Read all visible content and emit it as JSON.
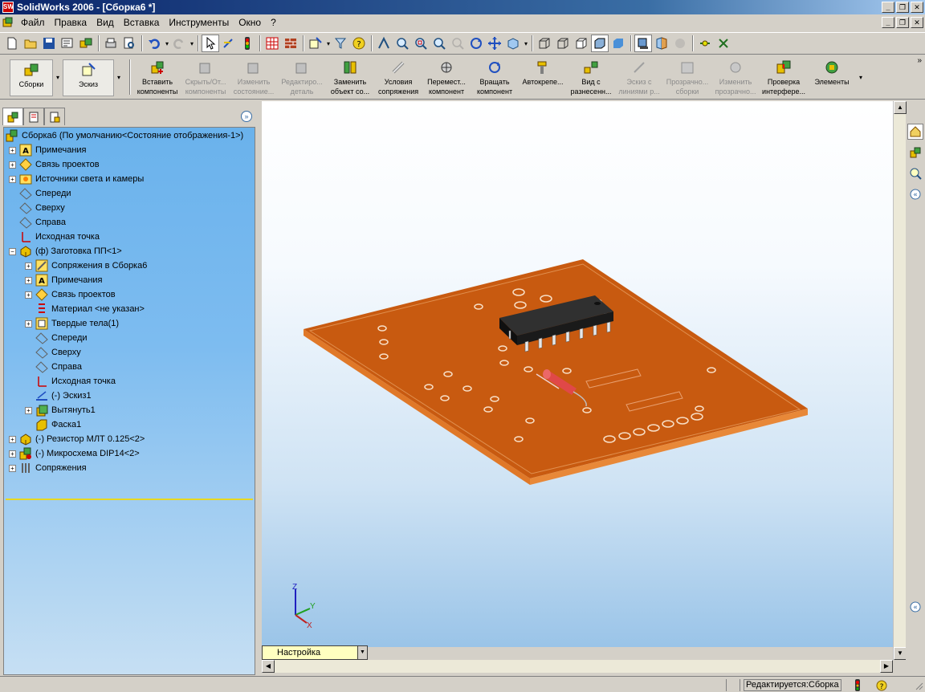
{
  "window": {
    "title": "SolidWorks 2006 - [Сборка6 *]",
    "app_icon": "SW"
  },
  "menu": {
    "items": [
      "Файл",
      "Правка",
      "Вид",
      "Вставка",
      "Инструменты",
      "Окно",
      "?"
    ]
  },
  "command_manager": {
    "items": [
      {
        "label": "Сборки",
        "enabled": true,
        "icon": "assembly-icon"
      },
      {
        "label": "Эскиз",
        "enabled": true,
        "icon": "sketch-icon"
      },
      {
        "label": "Вставить компоненты",
        "enabled": true,
        "icon": "insert-components-icon"
      },
      {
        "label": "Скрыть/От... компоненты",
        "enabled": false,
        "icon": "hide-show-components-icon"
      },
      {
        "label": "Изменить состояние...",
        "enabled": false,
        "icon": "change-state-icon"
      },
      {
        "label": "Редактиро... деталь",
        "enabled": false,
        "icon": "edit-part-icon"
      },
      {
        "label": "Заменить объект со...",
        "enabled": true,
        "icon": "replace-icon"
      },
      {
        "label": "Условия сопряжения",
        "enabled": true,
        "icon": "mate-icon"
      },
      {
        "label": "Перемест... компонент",
        "enabled": true,
        "icon": "move-component-icon"
      },
      {
        "label": "Вращать компонент",
        "enabled": true,
        "icon": "rotate-component-icon"
      },
      {
        "label": "Автокрепе...",
        "enabled": true,
        "icon": "smart-fasteners-icon"
      },
      {
        "label": "Вид с разнесенн...",
        "enabled": true,
        "icon": "exploded-view-icon"
      },
      {
        "label": "Эскиз с линиями р...",
        "enabled": false,
        "icon": "explode-line-sketch-icon"
      },
      {
        "label": "Прозрачно... сборки",
        "enabled": false,
        "icon": "assembly-transparency-icon"
      },
      {
        "label": "Изменить прозрачно...",
        "enabled": false,
        "icon": "change-transparency-icon"
      },
      {
        "label": "Проверка интерфере...",
        "enabled": true,
        "icon": "interference-detection-icon"
      },
      {
        "label": "Элементы",
        "enabled": true,
        "icon": "features-icon"
      }
    ]
  },
  "feature_tree": {
    "items": [
      {
        "label": "Сборка6  (По умолчанию<Состояние отображения-1>)",
        "level": 0,
        "expand": "",
        "icon": "assembly-icon"
      },
      {
        "label": "Примечания",
        "level": 1,
        "expand": "+",
        "icon": "annotations-icon"
      },
      {
        "label": "Связь проектов",
        "level": 1,
        "expand": "+",
        "icon": "design-binder-icon"
      },
      {
        "label": "Источники света и камеры",
        "level": 1,
        "expand": "+",
        "icon": "lights-cameras-icon"
      },
      {
        "label": "Спереди",
        "level": 1,
        "expand": "",
        "icon": "plane-icon"
      },
      {
        "label": "Сверху",
        "level": 1,
        "expand": "",
        "icon": "plane-icon"
      },
      {
        "label": "Справа",
        "level": 1,
        "expand": "",
        "icon": "plane-icon"
      },
      {
        "label": "Исходная точка",
        "level": 1,
        "expand": "",
        "icon": "origin-icon"
      },
      {
        "label": "(ф) Заготовка ПП<1>",
        "level": 1,
        "expand": "−",
        "icon": "part-icon"
      },
      {
        "label": "Сопряжения в Сборка6",
        "level": 2,
        "expand": "+",
        "icon": "mates-in-icon"
      },
      {
        "label": "Примечания",
        "level": 2,
        "expand": "+",
        "icon": "annotations-icon"
      },
      {
        "label": "Связь проектов",
        "level": 2,
        "expand": "+",
        "icon": "design-binder-icon"
      },
      {
        "label": "Материал <не указан>",
        "level": 2,
        "expand": "",
        "icon": "material-icon"
      },
      {
        "label": "Твердые тела(1)",
        "level": 2,
        "expand": "+",
        "icon": "solid-bodies-icon"
      },
      {
        "label": "Спереди",
        "level": 2,
        "expand": "",
        "icon": "plane-icon"
      },
      {
        "label": "Сверху",
        "level": 2,
        "expand": "",
        "icon": "plane-icon"
      },
      {
        "label": "Справа",
        "level": 2,
        "expand": "",
        "icon": "plane-icon"
      },
      {
        "label": "Исходная точка",
        "level": 2,
        "expand": "",
        "icon": "origin-icon"
      },
      {
        "label": "(-) Эскиз1",
        "level": 2,
        "expand": "",
        "icon": "sketch-icon"
      },
      {
        "label": "Вытянуть1",
        "level": 2,
        "expand": "+",
        "icon": "extrude-icon"
      },
      {
        "label": "Фаска1",
        "level": 2,
        "expand": "",
        "icon": "chamfer-icon"
      },
      {
        "label": "(-) Резистор МЛТ 0.125<2>",
        "level": 1,
        "expand": "+",
        "icon": "part-icon"
      },
      {
        "label": "(-) Микросхема DIP14<2>",
        "level": 1,
        "expand": "+",
        "icon": "subassembly-icon"
      },
      {
        "label": "Сопряжения",
        "level": 1,
        "expand": "+",
        "icon": "mates-icon"
      }
    ]
  },
  "triad": {
    "x": "X",
    "y": "Y",
    "z": "Z"
  },
  "configuration": {
    "value": "Настройка"
  },
  "status": {
    "editing": "Редактируется:Сборка"
  },
  "colors": {
    "tree_bg": "#7dbcf0",
    "pcb": "#c85a10",
    "pcb_edge": "#e07828",
    "chip": "#202020",
    "resistor": "#e05050",
    "rollback_bar": "#e8d820"
  }
}
